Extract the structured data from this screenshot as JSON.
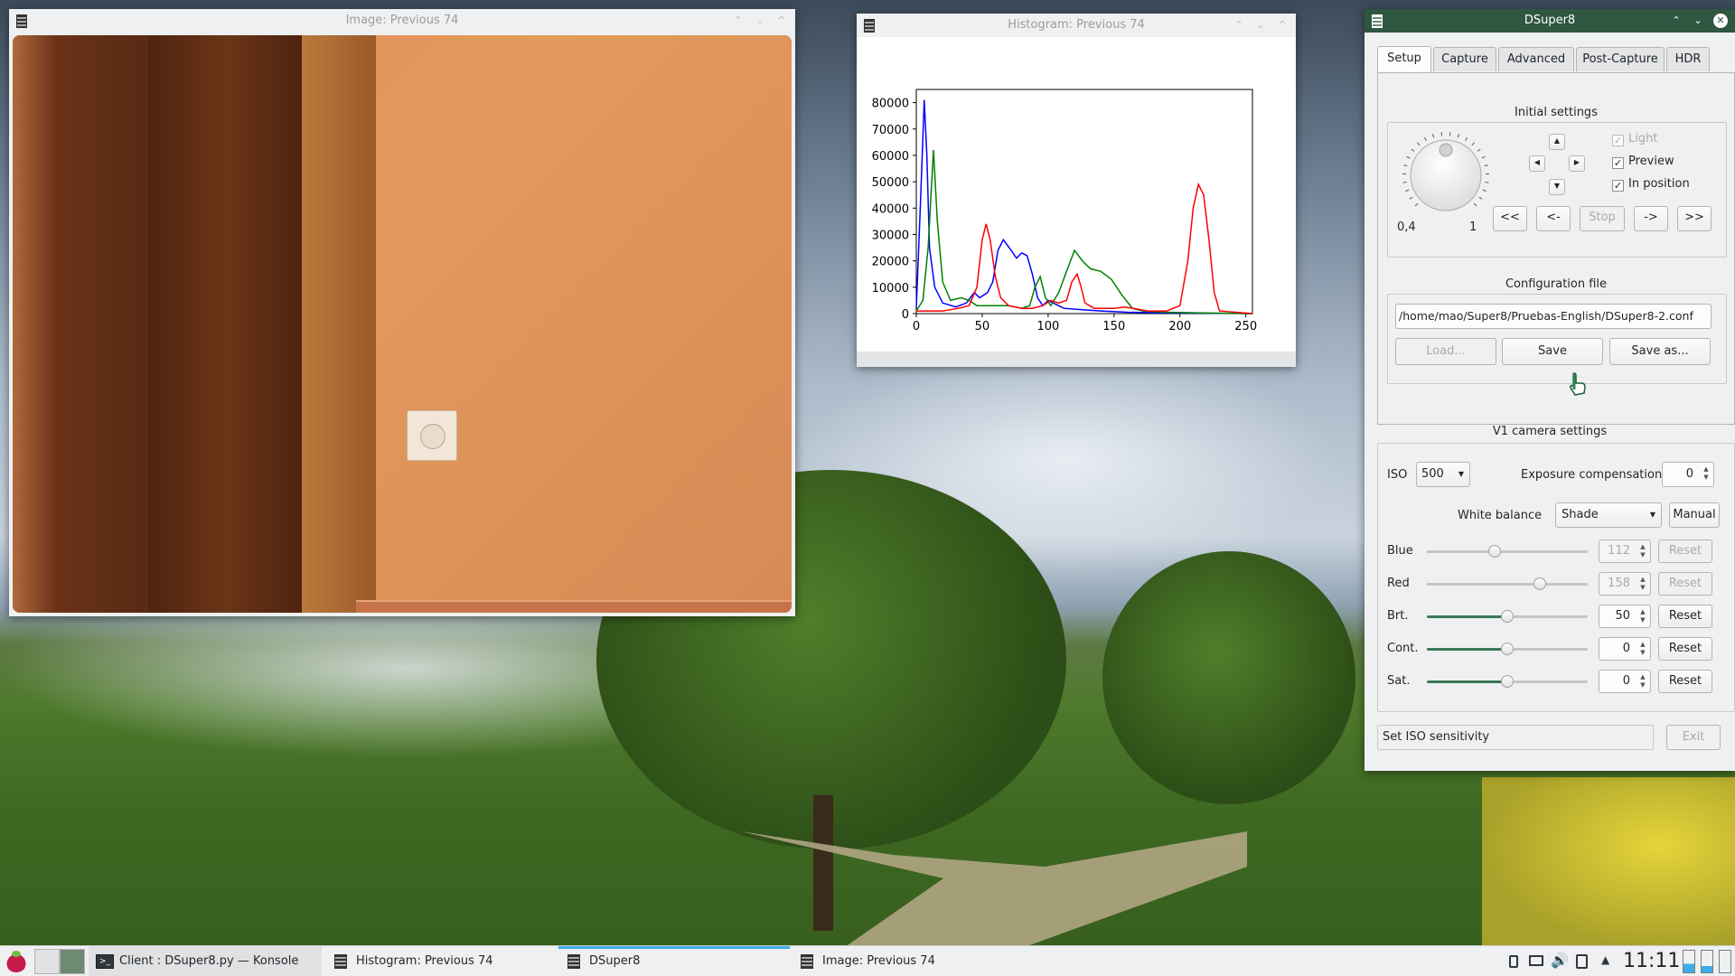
{
  "image_window": {
    "title": "Image: Previous 74"
  },
  "histogram_window": {
    "title": "Histogram: Previous 74",
    "chart_data": {
      "type": "line",
      "xlim": [
        0,
        255
      ],
      "ylim": [
        0,
        85000
      ],
      "x_ticks": [
        "0",
        "50",
        "100",
        "150",
        "200",
        "250"
      ],
      "y_ticks": [
        "0",
        "10000",
        "20000",
        "30000",
        "40000",
        "50000",
        "60000",
        "70000",
        "80000"
      ],
      "series": [
        {
          "color": "#0000ff",
          "points": [
            [
              0,
              2000
            ],
            [
              3,
              40000
            ],
            [
              6,
              81000
            ],
            [
              8,
              60000
            ],
            [
              10,
              25000
            ],
            [
              14,
              10000
            ],
            [
              20,
              4000
            ],
            [
              30,
              2500
            ],
            [
              38,
              4000
            ],
            [
              44,
              8000
            ],
            [
              48,
              6000
            ],
            [
              54,
              8000
            ],
            [
              58,
              12000
            ],
            [
              62,
              24000
            ],
            [
              66,
              28000
            ],
            [
              72,
              24000
            ],
            [
              76,
              21000
            ],
            [
              80,
              23000
            ],
            [
              84,
              22000
            ],
            [
              88,
              15000
            ],
            [
              92,
              6000
            ],
            [
              96,
              3000
            ],
            [
              100,
              5000
            ],
            [
              106,
              3500
            ],
            [
              112,
              2000
            ],
            [
              125,
              1500
            ],
            [
              140,
              1000
            ],
            [
              160,
              500
            ],
            [
              200,
              200
            ],
            [
              255,
              0
            ]
          ]
        },
        {
          "color": "#008000",
          "points": [
            [
              0,
              1000
            ],
            [
              5,
              5000
            ],
            [
              9,
              25000
            ],
            [
              13,
              62000
            ],
            [
              16,
              35000
            ],
            [
              20,
              12000
            ],
            [
              26,
              5000
            ],
            [
              34,
              6000
            ],
            [
              40,
              5000
            ],
            [
              46,
              3000
            ],
            [
              55,
              3000
            ],
            [
              70,
              3000
            ],
            [
              80,
              2000
            ],
            [
              86,
              3000
            ],
            [
              90,
              10000
            ],
            [
              94,
              14000
            ],
            [
              98,
              6000
            ],
            [
              102,
              3000
            ],
            [
              108,
              8000
            ],
            [
              114,
              16000
            ],
            [
              120,
              24000
            ],
            [
              126,
              20000
            ],
            [
              132,
              17000
            ],
            [
              140,
              16000
            ],
            [
              148,
              13000
            ],
            [
              156,
              7000
            ],
            [
              164,
              2000
            ],
            [
              172,
              1000
            ],
            [
              190,
              500
            ],
            [
              220,
              200
            ],
            [
              255,
              0
            ]
          ]
        },
        {
          "color": "#ff0000",
          "points": [
            [
              0,
              1000
            ],
            [
              20,
              1000
            ],
            [
              32,
              2000
            ],
            [
              40,
              3000
            ],
            [
              46,
              10000
            ],
            [
              50,
              28000
            ],
            [
              53,
              34000
            ],
            [
              56,
              28000
            ],
            [
              60,
              14000
            ],
            [
              64,
              6000
            ],
            [
              70,
              3000
            ],
            [
              80,
              2000
            ],
            [
              88,
              2000
            ],
            [
              96,
              3000
            ],
            [
              102,
              5000
            ],
            [
              108,
              4000
            ],
            [
              114,
              5000
            ],
            [
              118,
              12000
            ],
            [
              122,
              15000
            ],
            [
              125,
              10000
            ],
            [
              128,
              4000
            ],
            [
              135,
              2000
            ],
            [
              150,
              2000
            ],
            [
              158,
              2500
            ],
            [
              165,
              2000
            ],
            [
              175,
              1000
            ],
            [
              190,
              1000
            ],
            [
              200,
              3000
            ],
            [
              206,
              20000
            ],
            [
              210,
              40000
            ],
            [
              214,
              49000
            ],
            [
              218,
              45000
            ],
            [
              222,
              28000
            ],
            [
              226,
              8000
            ],
            [
              230,
              1000
            ],
            [
              255,
              0
            ]
          ]
        }
      ]
    }
  },
  "dsuper8_window": {
    "title": "DSuper8",
    "tabs": [
      "Setup",
      "Capture",
      "Advanced",
      "Post-Capture",
      "HDR"
    ],
    "initial_settings": {
      "title": "Initial settings",
      "dial_min": "0,4",
      "dial_max": "1",
      "nav_buttons": [
        "<<",
        "<-",
        "Stop",
        "->",
        ">>"
      ],
      "checkboxes": [
        {
          "label": "Light",
          "checked": true,
          "enabled": false
        },
        {
          "label": "Preview",
          "checked": true,
          "enabled": true
        },
        {
          "label": "In position",
          "checked": true,
          "enabled": true
        }
      ]
    },
    "config_file": {
      "title": "Configuration file",
      "path": "/home/mao/Super8/Pruebas-English/DSuper8-2.conf",
      "load_label": "Load...",
      "save_label": "Save",
      "save_as_label": "Save as..."
    },
    "camera": {
      "title": "V1 camera settings",
      "iso_label": "ISO",
      "iso_value": "500",
      "exposure_label": "Exposure compensation",
      "exposure_value": "0",
      "wb_label": "White balance",
      "wb_value": "Shade",
      "manual_label": "Manual",
      "reset_label": "Reset",
      "sliders": [
        {
          "label": "Blue",
          "value": "112",
          "level": 0.42,
          "enabled": false
        },
        {
          "label": "Red",
          "value": "158",
          "level": 0.7,
          "enabled": false
        },
        {
          "label": "Brt.",
          "value": "50",
          "level": 0.5,
          "enabled": true
        },
        {
          "label": "Cont.",
          "value": "0",
          "level": 0.5,
          "enabled": true
        },
        {
          "label": "Sat.",
          "value": "0",
          "level": 0.5,
          "enabled": true
        }
      ]
    },
    "status_text": "Set ISO sensitivity",
    "exit_label": "Exit"
  },
  "taskbar": {
    "tasks": [
      "Client : DSuper8.py — Konsole",
      "Histogram: Previous 74",
      "DSuper8",
      "Image: Previous 74"
    ],
    "clock": "11:11"
  }
}
